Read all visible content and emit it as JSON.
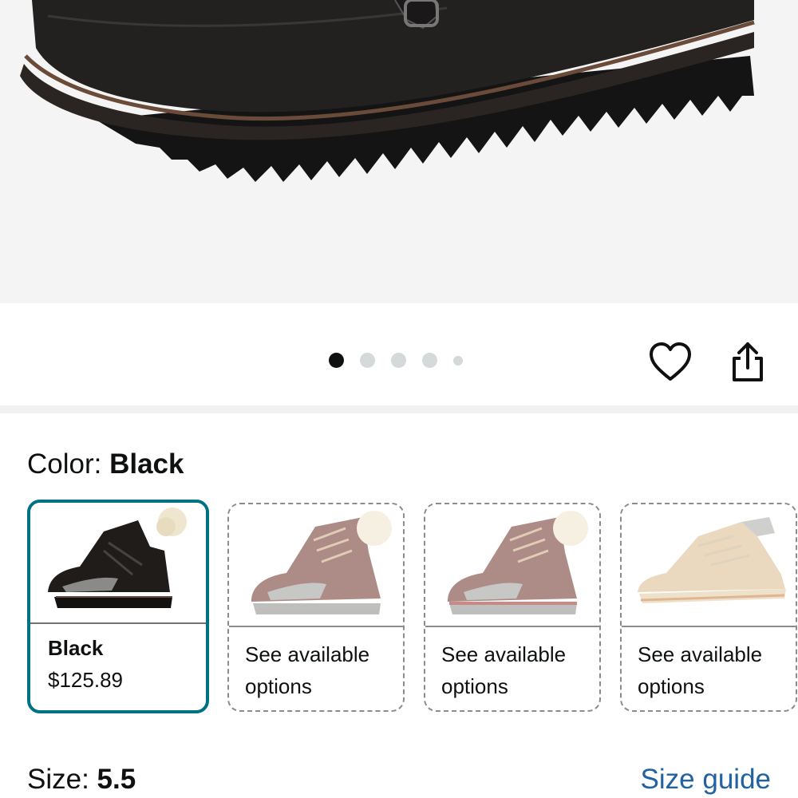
{
  "product": {
    "image_alt": "Black lace-up boot close-up"
  },
  "carousel": {
    "total_dots": 5,
    "active_index": 0
  },
  "actions": {
    "wishlist_icon": "heart-icon",
    "share_icon": "share-icon"
  },
  "color": {
    "label": "Color: ",
    "selected_value": "Black",
    "swatches": [
      {
        "name": "Black",
        "price": "$125.89",
        "state": "selected",
        "boot_color": "#1f1c1a"
      },
      {
        "line1": "See available",
        "line2": "options",
        "state": "unavailable",
        "boot_color": "#6b2f25"
      },
      {
        "line1": "See available",
        "line2": "options",
        "state": "unavailable",
        "boot_color": "#6b2f25"
      },
      {
        "line1": "See available",
        "line2": "options",
        "state": "unavailable",
        "boot_color": "#d9b98c"
      }
    ]
  },
  "size": {
    "label": "Size: ",
    "selected_value": "5.5",
    "guide_label": "Size guide"
  },
  "colors": {
    "accent_teal": "#007185",
    "link_blue": "#2162a1",
    "text": "#0f1111"
  }
}
